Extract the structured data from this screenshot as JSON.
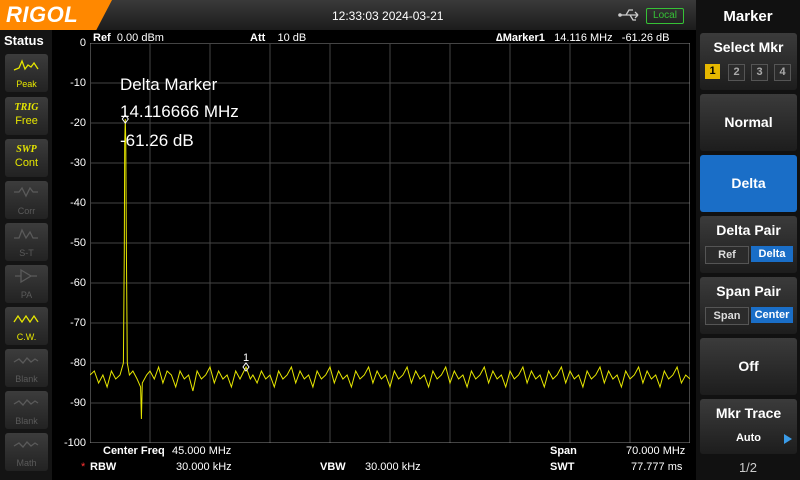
{
  "brand": "RIGOL",
  "datetime": "12:33:03 2024-03-21",
  "local_label": "Local",
  "status_panel": {
    "title": "Status",
    "items": [
      {
        "top": "Peak",
        "label": "Peak",
        "state": "on"
      },
      {
        "top": "TRIG",
        "label": "Free",
        "state": "on"
      },
      {
        "top": "SWP",
        "label": "Cont",
        "state": "on"
      },
      {
        "top": "",
        "label": "Corr",
        "state": "off"
      },
      {
        "top": "",
        "label": "S-T",
        "state": "off"
      },
      {
        "top": "",
        "label": "PA",
        "state": "off"
      },
      {
        "top": "",
        "label": "C.W.",
        "state": "on"
      },
      {
        "top": "",
        "label": "Blank",
        "state": "off"
      },
      {
        "top": "",
        "label": "Blank",
        "state": "off"
      },
      {
        "top": "",
        "label": "Math",
        "state": "off"
      }
    ]
  },
  "header": {
    "ref_label": "Ref",
    "ref_value": "0.00 dBm",
    "att_label": "Att",
    "att_value": "10 dB",
    "marker_label": "∆Marker1",
    "marker_freq": "14.116 MHz",
    "marker_amp": "-61.26 dB"
  },
  "y_axis": {
    "ticks": [
      "0",
      "-10",
      "-20",
      "-30",
      "-40",
      "-50",
      "-60",
      "-70",
      "-80",
      "-90",
      "-100"
    ]
  },
  "marker_readout": {
    "title": "Delta Marker",
    "freq": "14.116666 MHz",
    "amp": "-61.26 dB",
    "marker_number": "1"
  },
  "footer": {
    "center_label": "Center Freq",
    "center_value": "45.000 MHz",
    "span_label": "Span",
    "span_value": "70.000 MHz",
    "rbw_star": "*",
    "rbw_label": "RBW",
    "rbw_value": "30.000 kHz",
    "vbw_label": "VBW",
    "vbw_value": "30.000 kHz",
    "swt_label": "SWT",
    "swt_value": "77.777 ms"
  },
  "menu": {
    "title": "Marker",
    "select_mkr": {
      "label": "Select Mkr",
      "options": [
        "1",
        "2",
        "3",
        "4"
      ],
      "selected": "1"
    },
    "normal": "Normal",
    "delta": "Delta",
    "delta_pair": {
      "label": "Delta Pair",
      "ref": "Ref",
      "delta": "Delta",
      "selected": "Delta"
    },
    "span_pair": {
      "label": "Span Pair",
      "span": "Span",
      "center": "Center",
      "selected": "Center"
    },
    "off": "Off",
    "mkr_trace": {
      "label": "Mkr Trace",
      "value": "Auto"
    },
    "page": "1/2"
  },
  "colors": {
    "trace": "#e6e600",
    "accent": "#1a6ec7",
    "brand": "#ff8800",
    "local": "#36c236"
  },
  "chart_data": {
    "type": "line",
    "ylim": [
      -100,
      0
    ],
    "xlim_mhz": [
      10,
      80
    ],
    "series": [
      {
        "points": [
          [
            10,
            -83
          ],
          [
            10.5,
            -82
          ],
          [
            11,
            -85
          ],
          [
            11.5,
            -83
          ],
          [
            12,
            -86
          ],
          [
            12.5,
            -82
          ],
          [
            13,
            -84
          ],
          [
            13.5,
            -83
          ],
          [
            13.9,
            -80
          ],
          [
            14.0,
            -52
          ],
          [
            14.05,
            -25
          ],
          [
            14.117,
            -19
          ],
          [
            14.18,
            -25
          ],
          [
            14.25,
            -52
          ],
          [
            14.35,
            -80
          ],
          [
            14.6,
            -83
          ],
          [
            15,
            -82
          ],
          [
            15.5,
            -84
          ],
          [
            15.9,
            -86
          ],
          [
            16.0,
            -94
          ],
          [
            16.1,
            -85
          ],
          [
            16.6,
            -83
          ],
          [
            17,
            -82
          ],
          [
            17.5,
            -84
          ],
          [
            18,
            -81
          ],
          [
            18.5,
            -85
          ],
          [
            19,
            -82
          ],
          [
            19.5,
            -83
          ],
          [
            20,
            -86
          ],
          [
            20.5,
            -82
          ],
          [
            21,
            -84
          ],
          [
            21.5,
            -83
          ],
          [
            22,
            -87
          ],
          [
            22.5,
            -82
          ],
          [
            23,
            -84
          ],
          [
            23.5,
            -83
          ],
          [
            24,
            -81
          ],
          [
            24.5,
            -85
          ],
          [
            25,
            -82
          ],
          [
            25.5,
            -84
          ],
          [
            26,
            -83
          ],
          [
            26.5,
            -86
          ],
          [
            27,
            -82
          ],
          [
            27.5,
            -84
          ],
          [
            28.2,
            -81
          ],
          [
            28.7,
            -84
          ],
          [
            29,
            -83
          ],
          [
            29.5,
            -85
          ],
          [
            30,
            -82
          ],
          [
            30.5,
            -84
          ],
          [
            31,
            -83
          ],
          [
            31.5,
            -86
          ],
          [
            32,
            -82
          ],
          [
            32.5,
            -84
          ],
          [
            33,
            -83
          ],
          [
            33.5,
            -81
          ],
          [
            34,
            -85
          ],
          [
            34.5,
            -82
          ],
          [
            35,
            -84
          ],
          [
            35.5,
            -83
          ],
          [
            36,
            -86
          ],
          [
            36.5,
            -82
          ],
          [
            37,
            -84
          ],
          [
            37.5,
            -83
          ],
          [
            38,
            -81
          ],
          [
            38.5,
            -85
          ],
          [
            39,
            -82
          ],
          [
            39.5,
            -84
          ],
          [
            40,
            -83
          ],
          [
            40.5,
            -86
          ],
          [
            41,
            -82
          ],
          [
            41.5,
            -84
          ],
          [
            42,
            -83
          ],
          [
            42.5,
            -81
          ],
          [
            43,
            -85
          ],
          [
            43.5,
            -82
          ],
          [
            44,
            -84
          ],
          [
            44.5,
            -83
          ],
          [
            45,
            -86
          ],
          [
            45.5,
            -82
          ],
          [
            46,
            -84
          ],
          [
            46.5,
            -83
          ],
          [
            47,
            -81
          ],
          [
            47.5,
            -85
          ],
          [
            48,
            -82
          ],
          [
            48.5,
            -84
          ],
          [
            49,
            -83
          ],
          [
            49.5,
            -86
          ],
          [
            50,
            -82
          ],
          [
            50.5,
            -84
          ],
          [
            51,
            -83
          ],
          [
            51.5,
            -81
          ],
          [
            52,
            -85
          ],
          [
            52.5,
            -82
          ],
          [
            53,
            -84
          ],
          [
            53.5,
            -83
          ],
          [
            54,
            -86
          ],
          [
            54.5,
            -82
          ],
          [
            55,
            -84
          ],
          [
            55.5,
            -83
          ],
          [
            56,
            -81
          ],
          [
            56.5,
            -85
          ],
          [
            57,
            -82
          ],
          [
            57.5,
            -84
          ],
          [
            58,
            -83
          ],
          [
            58.5,
            -86
          ],
          [
            59,
            -82
          ],
          [
            59.5,
            -84
          ],
          [
            60,
            -83
          ],
          [
            60.5,
            -81
          ],
          [
            61,
            -85
          ],
          [
            61.5,
            -82
          ],
          [
            62,
            -84
          ],
          [
            62.5,
            -83
          ],
          [
            63,
            -86
          ],
          [
            63.5,
            -82
          ],
          [
            64,
            -84
          ],
          [
            64.5,
            -83
          ],
          [
            65,
            -81
          ],
          [
            65.5,
            -85
          ],
          [
            66,
            -82
          ],
          [
            66.5,
            -84
          ],
          [
            67,
            -83
          ],
          [
            67.5,
            -86
          ],
          [
            68,
            -82
          ],
          [
            68.5,
            -84
          ],
          [
            69,
            -83
          ],
          [
            69.5,
            -81
          ],
          [
            70,
            -85
          ],
          [
            70.5,
            -82
          ],
          [
            71,
            -84
          ],
          [
            71.5,
            -83
          ],
          [
            72,
            -86
          ],
          [
            72.5,
            -82
          ],
          [
            73,
            -84
          ],
          [
            73.5,
            -83
          ],
          [
            74,
            -81
          ],
          [
            74.5,
            -85
          ],
          [
            75,
            -82
          ],
          [
            75.5,
            -84
          ],
          [
            76,
            -83
          ],
          [
            76.5,
            -86
          ],
          [
            77,
            -82
          ],
          [
            77.5,
            -84
          ],
          [
            78,
            -83
          ],
          [
            78.5,
            -81
          ],
          [
            79,
            -85
          ],
          [
            79.5,
            -83
          ],
          [
            80,
            -84
          ]
        ]
      }
    ],
    "markers": [
      {
        "name": "ref",
        "freq_mhz": 14.117,
        "amp": -19
      },
      {
        "name": "1",
        "freq_mhz": 28.2,
        "amp": -81
      }
    ]
  }
}
